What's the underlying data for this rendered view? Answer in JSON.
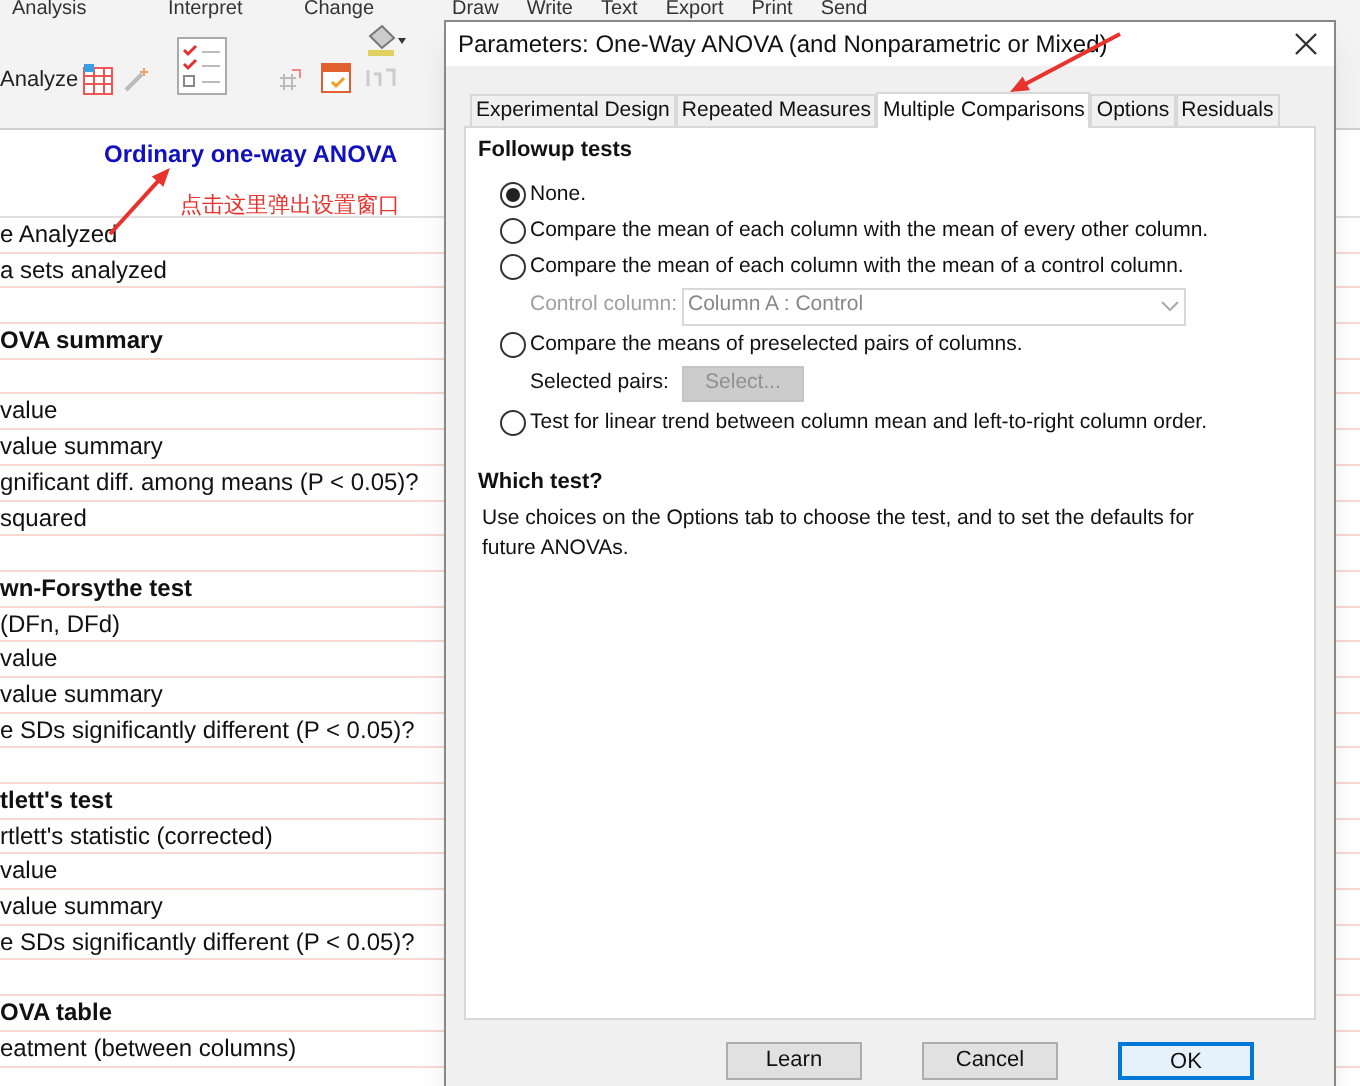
{
  "toolbar": {
    "groups": [
      "Analysis",
      "Interpret",
      "Change"
    ],
    "hidden_groups": [
      "Draw",
      "Write",
      "Text",
      "Export",
      "Print",
      "Send"
    ],
    "analyze_label": "Analyze"
  },
  "sheet": {
    "title": "Ordinary one-way ANOVA",
    "annotation": "点击这里弹出设置窗口",
    "rows": [
      {
        "kind": "item",
        "text": "e Analyzed"
      },
      {
        "kind": "item",
        "text": "a sets analyzed"
      },
      {
        "kind": "blank"
      },
      {
        "kind": "heading",
        "text": "OVA summary"
      },
      {
        "kind": "blank"
      },
      {
        "kind": "item",
        "text": "value"
      },
      {
        "kind": "item",
        "text": "value summary"
      },
      {
        "kind": "item",
        "text": "gnificant diff. among means (P < 0.05)?"
      },
      {
        "kind": "item",
        "text": "squared"
      },
      {
        "kind": "blank"
      },
      {
        "kind": "heading",
        "text": "wn-Forsythe test"
      },
      {
        "kind": "item",
        "text": "(DFn, DFd)"
      },
      {
        "kind": "item",
        "text": "value"
      },
      {
        "kind": "item",
        "text": "value summary"
      },
      {
        "kind": "item",
        "text": "e SDs significantly different (P < 0.05)?"
      },
      {
        "kind": "blank"
      },
      {
        "kind": "heading",
        "text": "tlett's test"
      },
      {
        "kind": "item",
        "text": "rtlett's statistic (corrected)"
      },
      {
        "kind": "item",
        "text": "value"
      },
      {
        "kind": "item",
        "text": "value summary"
      },
      {
        "kind": "item",
        "text": "e SDs significantly different (P < 0.05)?"
      },
      {
        "kind": "blank"
      },
      {
        "kind": "heading",
        "text": "OVA table"
      },
      {
        "kind": "item",
        "text": "eatment (between columns)"
      }
    ]
  },
  "dialog": {
    "title": "Parameters: One-Way ANOVA (and Nonparametric or Mixed)",
    "tabs": [
      {
        "label": "Experimental Design",
        "selected": false
      },
      {
        "label": "Repeated Measures",
        "selected": false
      },
      {
        "label": "Multiple Comparisons",
        "selected": true
      },
      {
        "label": "Options",
        "selected": false
      },
      {
        "label": "Residuals",
        "selected": false
      }
    ],
    "followup_title": "Followup tests",
    "options": [
      {
        "label": "None.",
        "selected": true
      },
      {
        "label": "Compare the mean of each column with the mean of every other column.",
        "selected": false
      },
      {
        "label": "Compare the mean of each column with the mean of a control column.",
        "selected": false,
        "control_column": {
          "label": "Control column:",
          "value": "Column A : Control",
          "disabled": true
        }
      },
      {
        "label": "Compare the means of preselected pairs of columns.",
        "selected": false,
        "selected_pairs": {
          "label": "Selected pairs:",
          "button": "Select...",
          "disabled": true
        }
      },
      {
        "label": "Test for linear trend between column mean and left-to-right column order.",
        "selected": false
      }
    ],
    "which_title": "Which test?",
    "which_text": "Use choices on the Options tab to choose the test, and to set the defaults for future ANOVAs.",
    "buttons": [
      {
        "label": "Learn",
        "default": false
      },
      {
        "label": "Cancel",
        "default": false
      },
      {
        "label": "OK",
        "default": true
      }
    ]
  }
}
